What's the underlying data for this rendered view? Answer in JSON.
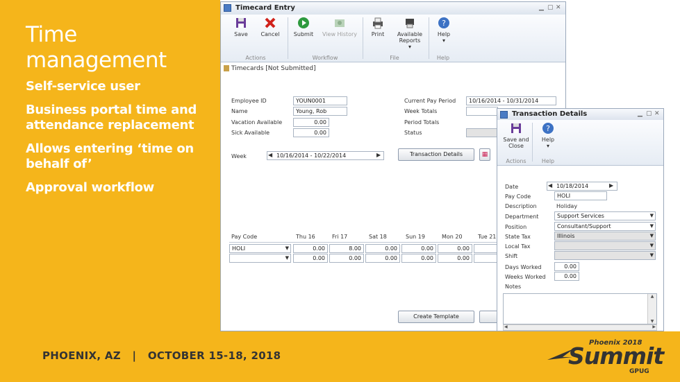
{
  "slide": {
    "title": "Time management",
    "bullets": [
      "Self-service user",
      "Business portal time and attendance replacement",
      "Allows entering ‘time on behalf of’",
      "Approval workflow"
    ],
    "footer": "PHOENIX, AZ   |   OCTOBER 15-18, 2018",
    "logo": {
      "top": "Phoenix 2018",
      "main": "Summit",
      "sub": "GPUG"
    },
    "colors": {
      "brand": "#f5b51b",
      "accent": "#333333"
    }
  },
  "main_window": {
    "title": "Timecard Entry",
    "ribbon": {
      "save": "Save",
      "cancel": "Cancel",
      "submit": "Submit",
      "view_history": "View History",
      "print": "Print",
      "available_reports": "Available Reports",
      "help": "Help",
      "groups": {
        "actions": "Actions",
        "workflow": "Workflow",
        "file": "File",
        "help": "Help"
      }
    },
    "header": "Timecards [Not Submitted]",
    "fields": {
      "employee_id_label": "Employee ID",
      "employee_id": "YOUN0001",
      "name_label": "Name",
      "name": "Young, Rob",
      "vacation_label": "Vacation Available",
      "vacation": "0.00",
      "sick_label": "Sick Available",
      "sick": "0.00",
      "current_pay_period_label": "Current Pay Period",
      "current_pay_period": "10/16/2014 - 10/31/2014",
      "week_totals_label": "Week Totals",
      "period_totals_label": "Period Totals",
      "status_label": "Status",
      "week_label": "Week",
      "week": "10/16/2014 - 10/22/2014"
    },
    "buttons": {
      "transaction_details": "Transaction Details",
      "create_template": "Create Template"
    },
    "grid": {
      "headers": [
        "Pay Code",
        "Thu 16",
        "Fri 17",
        "Sat 18",
        "Sun 19",
        "Mon 20",
        "Tue 21"
      ],
      "rows": [
        {
          "pay_code": "HOLI",
          "values": [
            "0.00",
            "8.00",
            "0.00",
            "0.00",
            "0.00"
          ]
        },
        {
          "pay_code": "",
          "values": [
            "0.00",
            "0.00",
            "0.00",
            "0.00",
            "0.00"
          ]
        }
      ]
    }
  },
  "transaction_window": {
    "title": "Transaction Details",
    "ribbon": {
      "save_close": "Save and Close",
      "help": "Help",
      "groups": {
        "actions": "Actions",
        "help": "Help"
      }
    },
    "fields": {
      "date_label": "Date",
      "date": "10/18/2014",
      "pay_code_label": "Pay Code",
      "pay_code": "HOLI",
      "description_label": "Description",
      "description": "Holiday",
      "department_label": "Department",
      "department": "Support Services",
      "position_label": "Position",
      "position": "Consultant/Support",
      "state_tax_label": "State Tax",
      "state_tax": "Illinois",
      "local_tax_label": "Local Tax",
      "local_tax": "",
      "shift_label": "Shift",
      "shift": "",
      "days_worked_label": "Days Worked",
      "days_worked": "0.00",
      "weeks_worked_label": "Weeks Worked",
      "weeks_worked": "0.00",
      "notes_label": "Notes"
    }
  }
}
